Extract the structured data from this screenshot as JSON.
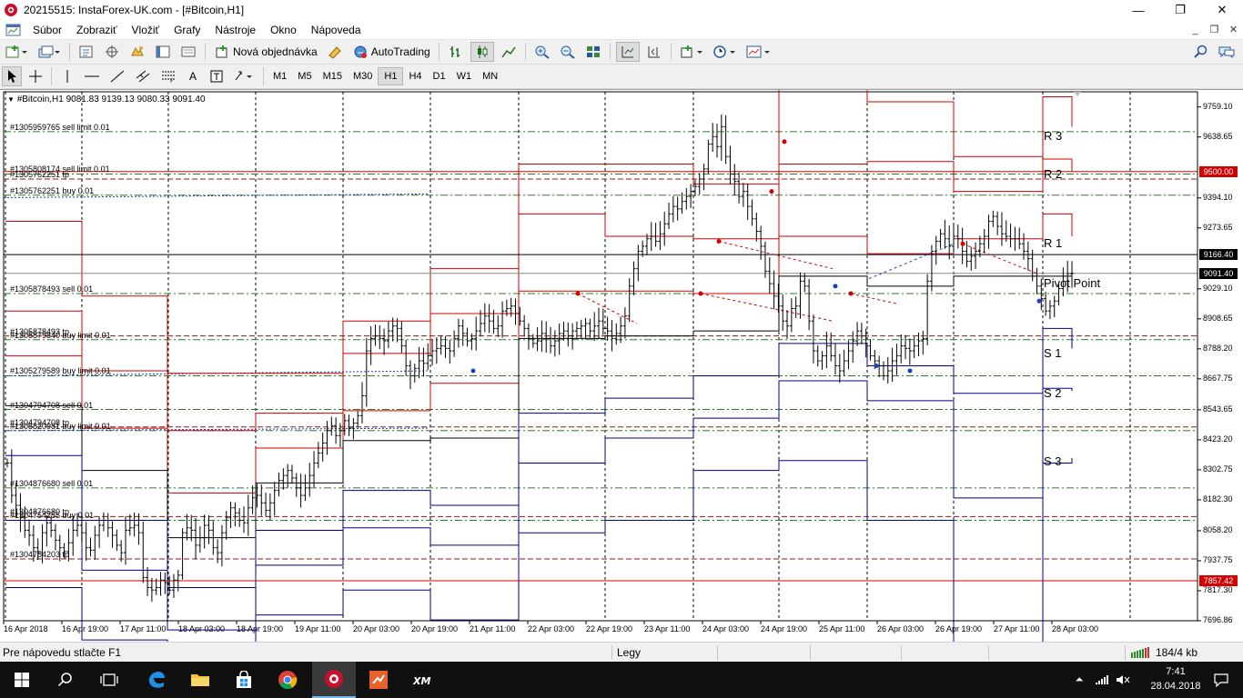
{
  "window": {
    "title": "20215515: InstaForex-UK.com - [#Bitcoin,H1]",
    "minimize": "—",
    "maximize": "❐",
    "close": "✕"
  },
  "menu": {
    "items": [
      "Súbor",
      "Zobraziť",
      "Vložiť",
      "Grafy",
      "Nástroje",
      "Okno",
      "Nápoveda"
    ],
    "child_controls": [
      "_",
      "❐",
      "✕"
    ]
  },
  "toolbar1": {
    "new_order_label": "Nová objednávka",
    "autotrading_label": "AutoTrading"
  },
  "toolbar2": {
    "timeframes": [
      "M1",
      "M5",
      "M15",
      "M30",
      "H1",
      "H4",
      "D1",
      "W1",
      "MN"
    ],
    "active_timeframe": "H1",
    "text_tool": "A"
  },
  "chart": {
    "info_line": "#Bitcoin,H1  9081.83 9139.13 9080.33 9091.40",
    "colors": {
      "resistance": "#d00000",
      "support": "#000090",
      "pivot": "#000000",
      "grid_buy": "#2d7a2d",
      "grid_sell": "#8b1a1a",
      "bar": "#000000"
    }
  },
  "chart_data": {
    "type": "candlestick",
    "symbol": "#Bitcoin",
    "timeframe": "H1",
    "ohlc_last": {
      "open": 9081.83,
      "high": 9139.13,
      "low": 9080.33,
      "close": 9091.4
    },
    "ylim": [
      7696.86,
      9820
    ],
    "y_ticks": [
      9759.1,
      9638.65,
      9516.2,
      9394.1,
      9273.65,
      9151.2,
      9029.1,
      8908.65,
      8788.2,
      8667.75,
      8543.65,
      8423.2,
      8302.75,
      8182.3,
      8058.2,
      7937.75,
      7817.3,
      7696.86
    ],
    "y_tick_labels": [
      "9759.10",
      "9638.65",
      "9394.10",
      "9273.65",
      "9029.10",
      "8908.65",
      "8788.20",
      "8667.75",
      "8543.65",
      "8423.20",
      "8302.75",
      "8182.30",
      "8058.20",
      "7937.75",
      "7817.30",
      "7696.86"
    ],
    "x_labels": [
      "16 Apr 2018",
      "16 Apr 19:00",
      "17 Apr 11:00",
      "18 Apr 03:00",
      "18 Apr 19:00",
      "19 Apr 11:00",
      "20 Apr 03:00",
      "20 Apr 19:00",
      "21 Apr 11:00",
      "22 Apr 03:00",
      "22 Apr 19:00",
      "23 Apr 11:00",
      "24 Apr 03:00",
      "24 Apr 19:00",
      "25 Apr 11:00",
      "26 Apr 03:00",
      "26 Apr 19:00",
      "27 Apr 11:00",
      "28 Apr 03:00"
    ],
    "price_badges": [
      {
        "label": "9500.00",
        "value": 9500.0,
        "bg": "#d40000",
        "fg": "#ffffff"
      },
      {
        "label": "9166.40",
        "value": 9166.4,
        "bg": "#000000",
        "fg": "#ffffff"
      },
      {
        "label": "9091.40",
        "value": 9091.4,
        "bg": "#000000",
        "fg": "#ffffff"
      },
      {
        "label": "7857.42",
        "value": 7857.42,
        "bg": "#d40000",
        "fg": "#ffffff"
      }
    ],
    "pivot_labels": [
      {
        "text": "R 3",
        "value": 9640
      },
      {
        "text": "R 2",
        "value": 9488
      },
      {
        "text": "R 1",
        "value": 9210
      },
      {
        "text": "Pivot Point",
        "value": 9050
      },
      {
        "text": "S 1",
        "value": 8770
      },
      {
        "text": "S 2",
        "value": 8610
      },
      {
        "text": "S 3",
        "value": 8335
      }
    ],
    "order_lines": [
      {
        "label": "#1305959765 sell limit 0.01",
        "value": 9660
      },
      {
        "label": "#1305808174 sell limit 0.01",
        "value": 9490
      },
      {
        "label": "#1305762251 tp",
        "value": 9470
      },
      {
        "label": "#1305762251 buy 0.01",
        "value": 9405
      },
      {
        "label": "#1305878493 sell 0.01",
        "value": 9010
      },
      {
        "label": "#1305878493 tp",
        "value": 8840
      },
      {
        "label": "#1305879840 buy limit 0.01",
        "value": 8825
      },
      {
        "label": "#1305279589 buy limit 0.01",
        "value": 8680
      },
      {
        "label": "#1304794708 sell 0.01",
        "value": 8545
      },
      {
        "label": "#1304794708 tp",
        "value": 8475
      },
      {
        "label": "#1305820981 buy limit 0.01",
        "value": 8460
      },
      {
        "label": "#1304876680 sell 0.01",
        "value": 8230
      },
      {
        "label": "#1304876680 tp",
        "value": 8115
      },
      {
        "label": "#1304754255 buy 0.01",
        "value": 8100
      },
      {
        "label": "#1304754203 tp",
        "value": 7945
      }
    ],
    "pivot_days": [
      {
        "r3": 9300,
        "r2": 8940,
        "r1": 8760,
        "p": 8560,
        "s1": 8360,
        "s2": 8100,
        "s3": 7830
      },
      {
        "r3": 9000,
        "r2": 8700,
        "r1": 8470,
        "p": 8300,
        "s1": 8100,
        "s2": 7900,
        "s3": 7620
      },
      {
        "r3": 8690,
        "r2": 8460,
        "r1": 8210,
        "p": 8030,
        "s1": 7830,
        "s2": 7660,
        "s3": 7370
      },
      {
        "r3": 8690,
        "r2": 8530,
        "r1": 8390,
        "p": 8250,
        "s1": 8060,
        "s2": 7920,
        "s3": 7720
      },
      {
        "r3": 8900,
        "r2": 8770,
        "r1": 8540,
        "p": 8420,
        "s1": 8220,
        "s2": 8070,
        "s3": 7820
      },
      {
        "r3": 9110,
        "r2": 8930,
        "r1": 8650,
        "p": 8430,
        "s1": 8160,
        "s2": 8000,
        "s3": 7700
      },
      {
        "r3": 9530,
        "r2": 9330,
        "r1": 9020,
        "p": 8830,
        "s1": 8530,
        "s2": 8330,
        "s3": 8050
      },
      {
        "r3": 9530,
        "r2": 9240,
        "r1": 9020,
        "p": 8840,
        "s1": 8590,
        "s2": 8430,
        "s3": 8100
      },
      {
        "r3": 9450,
        "r2": 9230,
        "r1": 9010,
        "p": 8860,
        "s1": 8680,
        "s2": 8510,
        "s3": 8300
      },
      {
        "r3": 9830,
        "r2": 9530,
        "r1": 9240,
        "p": 9080,
        "s1": 8810,
        "s2": 8660,
        "s3": 8340
      },
      {
        "r3": 9780,
        "r2": 9540,
        "r1": 9170,
        "p": 9040,
        "s1": 8720,
        "s2": 8580,
        "s3": 8100
      },
      {
        "r3": 9560,
        "r2": 9420,
        "r1": 9230,
        "p": 9080,
        "s1": 8610,
        "s2": 8190,
        "s3": 7470
      },
      {
        "r3": 9800,
        "r2": 9550,
        "r1": 9330,
        "p": 9080,
        "s1": 8870,
        "s2": 8630,
        "s3": 8330
      },
      {
        "r3": 9680,
        "r2": 9500,
        "r1": 9240,
        "p": 9050,
        "s1": 8790,
        "s2": 8620,
        "s3": 8350
      }
    ],
    "pivot_day_x": [
      6,
      90,
      184,
      281,
      377,
      473,
      570,
      665,
      762,
      856,
      953,
      1048,
      1146,
      1178
    ],
    "grid_x": [
      6,
      90,
      185,
      281,
      377,
      473,
      570,
      665,
      762,
      856,
      953,
      1048,
      1146,
      1242
    ],
    "close_path": [
      8330,
      8200,
      8160,
      8110,
      8060,
      8040,
      7990,
      7970,
      8050,
      8090,
      8060,
      8020,
      7990,
      7975,
      8010,
      8060,
      8080,
      8050,
      7990,
      7980,
      8040,
      8080,
      8100,
      8070,
      8040,
      8000,
      7970,
      8060,
      8070,
      8080,
      8050,
      7870,
      7830,
      7820,
      7830,
      7860,
      7850,
      7820,
      7860,
      7880,
      8050,
      8070,
      8060,
      8000,
      8030,
      8080,
      8060,
      7990,
      7970,
      8050,
      8110,
      8150,
      8130,
      8100,
      8090,
      8150,
      8190,
      8200,
      8170,
      8140,
      8170,
      8220,
      8260,
      8280,
      8300,
      8270,
      8230,
      8200,
      8230,
      8280,
      8330,
      8370,
      8410,
      8460,
      8480,
      8440,
      8460,
      8500,
      8470,
      8490,
      8520,
      8600,
      8780,
      8830,
      8840,
      8830,
      8820,
      8860,
      8880,
      8870,
      8800,
      8720,
      8680,
      8710,
      8740,
      8730,
      8760,
      8780,
      8790,
      8800,
      8790,
      8780,
      8830,
      8880,
      8850,
      8820,
      8830,
      8860,
      8890,
      8920,
      8900,
      8870,
      8880,
      8940,
      8950,
      8960,
      8930,
      8900,
      8870,
      8830,
      8810,
      8820,
      8850,
      8830,
      8800,
      8820,
      8850,
      8860,
      8840,
      8860,
      8870,
      8880,
      8890,
      8860,
      8880,
      8900,
      8870,
      8860,
      8830,
      8850,
      8880,
      8920,
      9040,
      9110,
      9180,
      9200,
      9230,
      9240,
      9220,
      9250,
      9290,
      9330,
      9360,
      9350,
      9380,
      9400,
      9420,
      9440,
      9470,
      9510,
      9610,
      9640,
      9600,
      9680,
      9560,
      9490,
      9460,
      9400,
      9420,
      9360,
      9310,
      9260,
      9200,
      9100,
      9050,
      9000,
      8960,
      8900,
      8880,
      8950,
      8960,
      9060,
      9040,
      8900,
      8780,
      8740,
      8760,
      8800,
      8760,
      8720,
      8700,
      8740,
      8780,
      8820,
      8860,
      8840,
      8800,
      8760,
      8740,
      8720,
      8680,
      8700,
      8740,
      8760,
      8800,
      8790,
      8780,
      8800,
      8820,
      8830,
      9060,
      9180,
      9220,
      9250,
      9230,
      9200,
      9240,
      9230,
      9180,
      9140,
      9160,
      9180,
      9210,
      9240,
      9300,
      9320,
      9280,
      9250,
      9240,
      9230,
      9230,
      9210,
      9180,
      9150,
      9080,
      9040,
      8990,
      8940,
      8960,
      8980,
      9030,
      9060,
      9090,
      9091
    ]
  },
  "status": {
    "help": "Pre nápovedu stlačte F1",
    "profile": "Legy",
    "traffic": "184/4 kb"
  },
  "taskbar": {
    "time": "7:41",
    "date": "28.04.2018",
    "tray_lang": "⏶"
  }
}
